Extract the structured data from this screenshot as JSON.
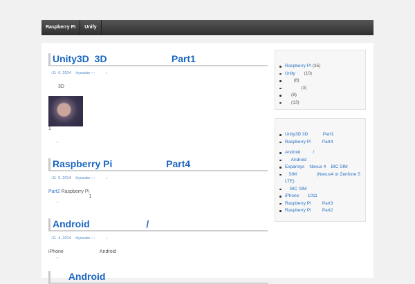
{
  "nav": [
    "Raspberry PI",
    "Unify"
  ],
  "posts": [
    {
      "title": "Unity3D  3D                        Part1",
      "meta": ":11  6, 2014    :kyosuke —          ↓",
      "lines": [
        "3D"
      ],
      "after_image": "1",
      "comma": ","
    },
    {
      "title": "Raspberry Pi                    Part4",
      "meta": ":11  5, 2014    :kyosuke —          ↓",
      "link": "Part2",
      "lines_after_link": " Raspberry Pi",
      "line2": "                              1",
      "comma": ","
    },
    {
      "title": "Android                     /",
      "meta": ":11  4, 2014    :kyosuke —          ↓",
      "lines": [
        "iPhone                           Android"
      ],
      "comma": ","
    },
    {
      "title": "      Android"
    }
  ],
  "categories": [
    {
      "name": "Raspberry PI",
      "count": " (35)"
    },
    {
      "name": "Unity",
      "count": "       (10)"
    },
    {
      "name": "",
      "count": "       (8)"
    },
    {
      "name": "",
      "count": "             (3)"
    },
    {
      "name": "",
      "count": "     (8)"
    },
    {
      "name": "",
      "count": "     (13)"
    }
  ],
  "recent_posts": [
    "Unity3D 3D            Part1",
    "Raspberry Pi         Part4",
    "Android          /",
    "     Android",
    "Expansys    Nexus 4    BIC SIM",
    "   SIM                (Nexus4 or Zenfone 5 LTE)",
    "    BIC SIM",
    "iPhone       1011",
    "Raspberry Pi         Part3",
    "Raspberry Pi         Part2"
  ]
}
